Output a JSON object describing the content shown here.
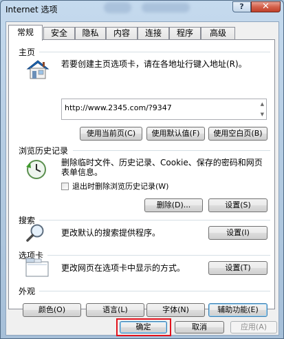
{
  "window": {
    "title": "Internet 选项",
    "help_glyph": "?",
    "close_glyph": "✕"
  },
  "tabs": [
    "常规",
    "安全",
    "隐私",
    "内容",
    "连接",
    "程序",
    "高级"
  ],
  "home": {
    "section": "主页",
    "description": "若要创建主页选项卡，请在各地址行键入地址(R)。",
    "url": "http://www.2345.com/?9347",
    "buttons": [
      "使用当前页(C)",
      "使用默认值(F)",
      "使用空白页(B)"
    ]
  },
  "history": {
    "section": "浏览历史记录",
    "description_line1": "删除临时文件、历史记录、Cookie、保存的密码和网页",
    "description_line2": "表单信息。",
    "checkbox_label": "退出时删除浏览历史记录(W)",
    "delete_button": "删除(D)...",
    "settings_button": "设置(S)"
  },
  "search": {
    "section": "搜索",
    "description": "更改默认的搜索提供程序。",
    "settings_button": "设置(I)"
  },
  "tabs_section": {
    "section": "选项卡",
    "description": "更改网页在选项卡中显示的方式。",
    "settings_button": "设置(T)"
  },
  "appearance": {
    "section": "外观",
    "buttons": [
      "颜色(O)",
      "语言(L)",
      "字体(N)",
      "辅助功能(E)"
    ]
  },
  "footer": {
    "ok": "确定",
    "cancel": "取消",
    "apply": "应用(A)"
  },
  "colors": {
    "highlight": "#e2121c",
    "close": "#c0402a"
  }
}
